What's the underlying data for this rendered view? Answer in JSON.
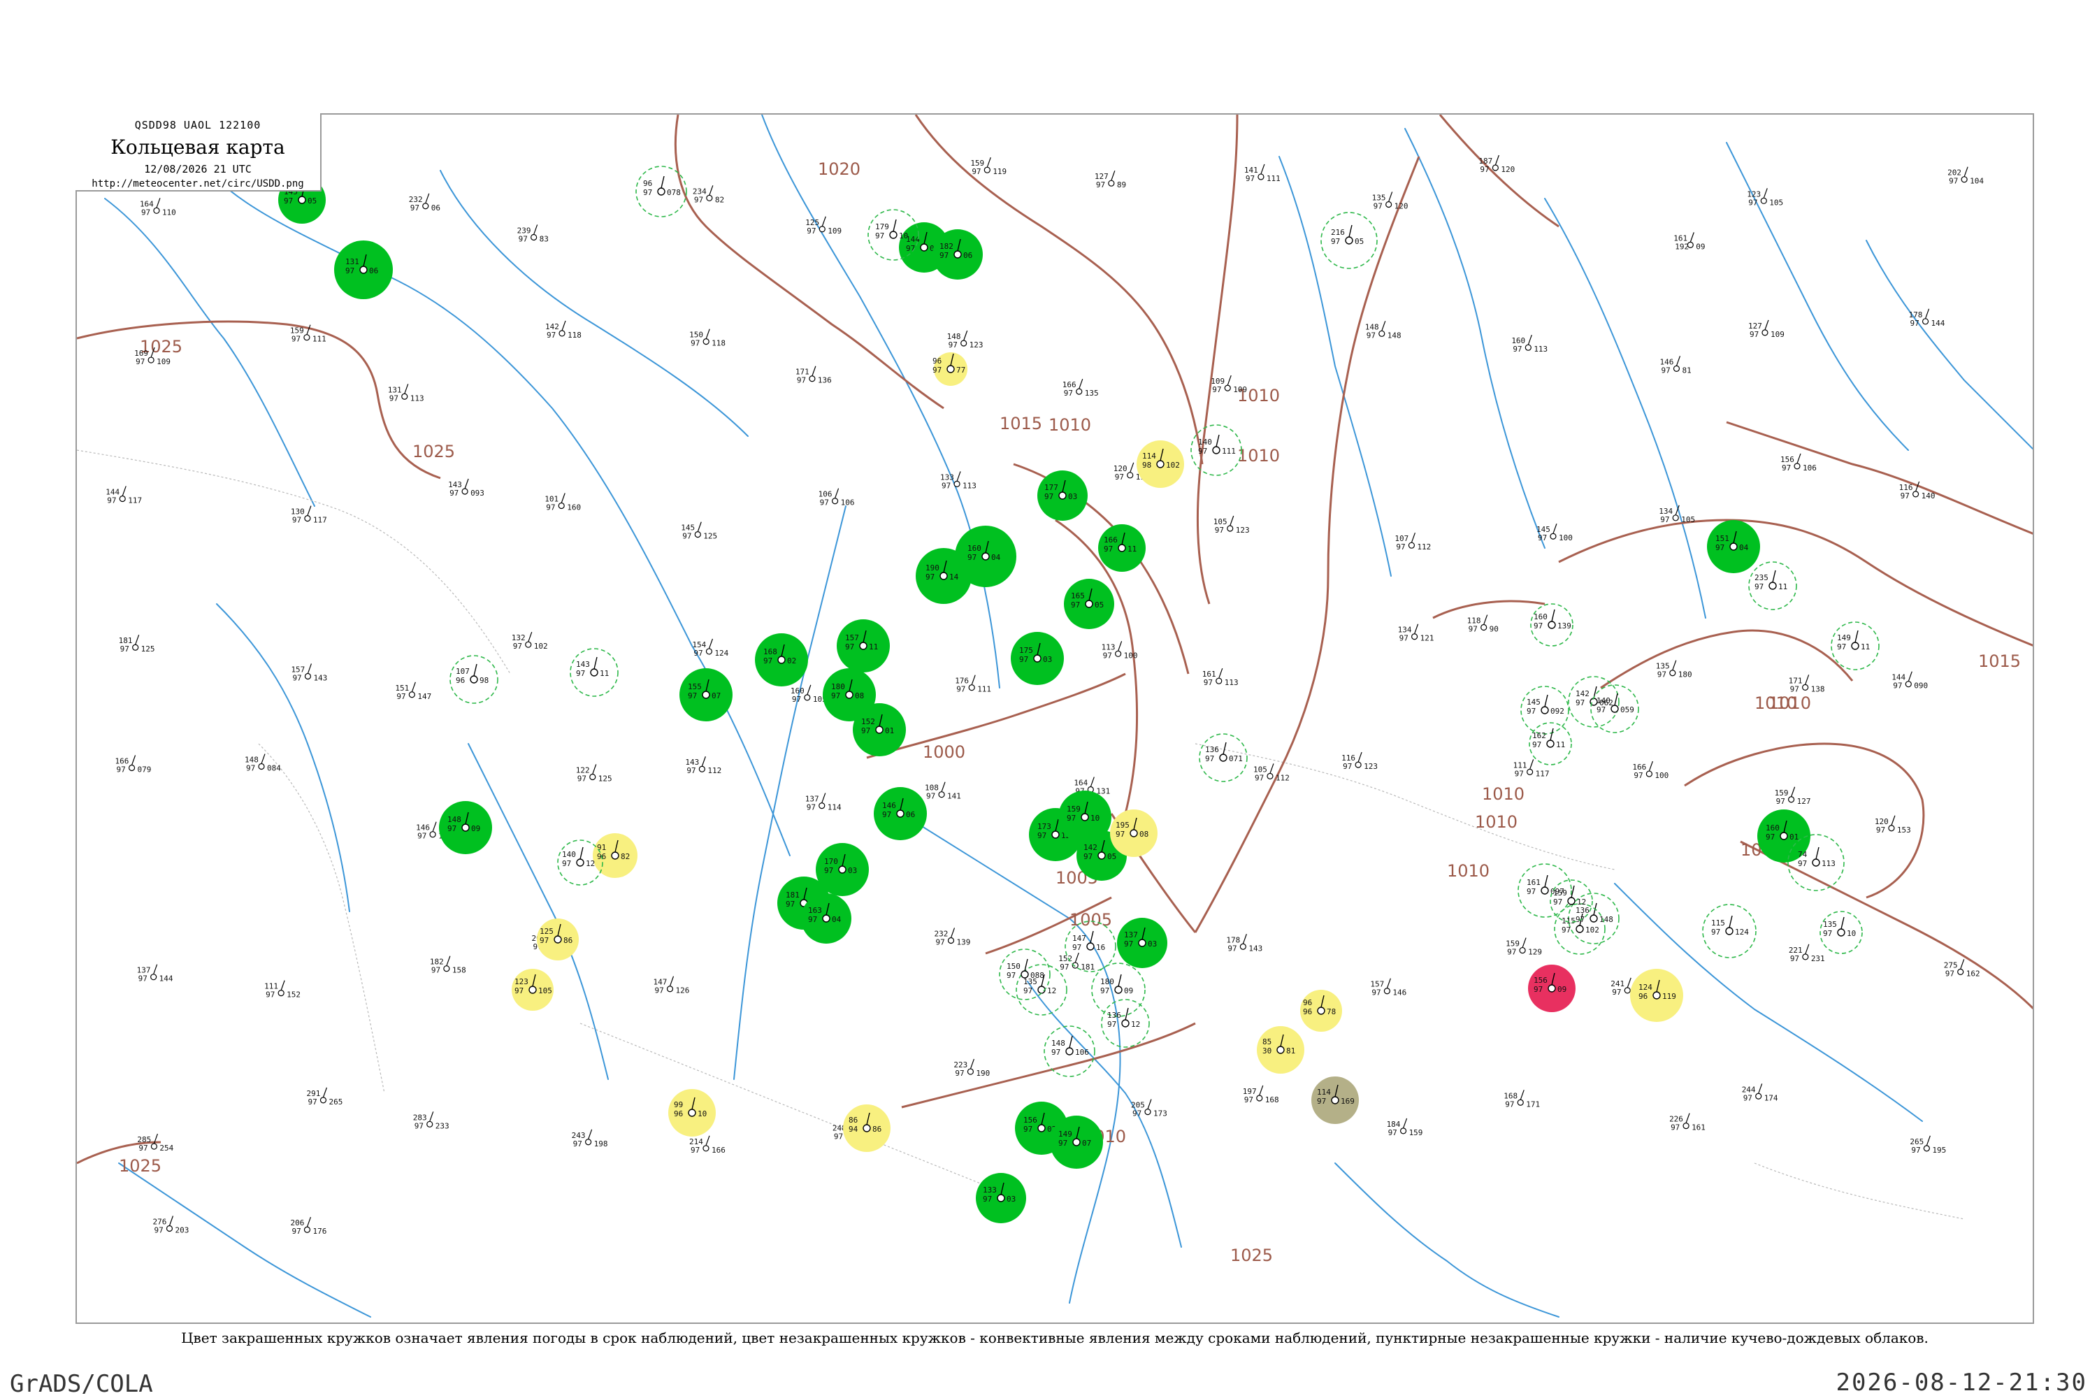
{
  "header": {
    "code": "QSDD98  UAOL  122100",
    "title": "Кольцевая карта",
    "date": "12/08/2026 21 UTC",
    "url": "http://meteocenter.net/circ/USDD.png"
  },
  "caption": "Цвет закрашенных кружков означает явления погоды в срок наблюдений, цвет незакрашенных кружков - конвективные явления между сроками наблюдений, пунктирные незакрашенные кружки - наличие кучево-дождевых облаков.",
  "footer": {
    "left": "GrADS/COLA",
    "right": "2026-08-12-21:30"
  },
  "colors": {
    "rain": "#00c020",
    "drizzle": "#f8f080",
    "thunder_heavy": "#e83060",
    "mixed": "#b4b088",
    "cb_dashed": "#2eb84a",
    "isobar": "#a86050",
    "river": "#3c96d8",
    "border": "#b8b8b8"
  },
  "isobar_labels": [
    {
      "text": "1025"
    },
    {
      "text": "1025"
    },
    {
      "text": "1025"
    },
    {
      "text": "1020"
    },
    {
      "text": "1015"
    },
    {
      "text": "1010"
    },
    {
      "text": "1010"
    },
    {
      "text": "1005"
    },
    {
      "text": "1000"
    },
    {
      "text": "1005"
    },
    {
      "text": "1010"
    },
    {
      "text": "1010"
    },
    {
      "text": "1010"
    },
    {
      "text": "1010"
    },
    {
      "text": "1015"
    },
    {
      "text": "1010"
    },
    {
      "text": "1000"
    },
    {
      "text": "1010"
    },
    {
      "text": "1010"
    },
    {
      "text": "1025"
    }
  ],
  "stations": [
    {
      "kind": "filled",
      "color": "rain",
      "t": "145",
      "p": "97",
      "w": "05"
    },
    {
      "kind": "filled",
      "color": "rain",
      "t": "131",
      "p": "97",
      "w": "06"
    },
    {
      "kind": "filled",
      "color": "rain",
      "t": "144",
      "p": "97",
      "w": "04"
    },
    {
      "kind": "filled",
      "color": "rain",
      "t": "182",
      "p": "97",
      "w": "06"
    },
    {
      "kind": "filled",
      "color": "rain",
      "t": "177",
      "p": "97",
      "w": "03"
    },
    {
      "kind": "filled",
      "color": "rain",
      "t": "166",
      "p": "97",
      "w": "11"
    },
    {
      "kind": "filled",
      "color": "rain",
      "t": "160",
      "p": "97",
      "w": "04"
    },
    {
      "kind": "filled",
      "color": "rain",
      "t": "190",
      "p": "97",
      "w": "14"
    },
    {
      "kind": "filled",
      "color": "rain",
      "t": "165",
      "p": "97",
      "w": "05"
    },
    {
      "kind": "filled",
      "color": "rain",
      "t": "175",
      "p": "97",
      "w": "03"
    },
    {
      "kind": "filled",
      "color": "rain",
      "t": "157",
      "p": "97",
      "w": "11"
    },
    {
      "kind": "filled",
      "color": "rain",
      "t": "168",
      "p": "97",
      "w": "02"
    },
    {
      "kind": "filled",
      "color": "rain",
      "t": "180",
      "p": "97",
      "w": "08"
    },
    {
      "kind": "filled",
      "color": "rain",
      "t": "152",
      "p": "97",
      "w": "01"
    },
    {
      "kind": "filled",
      "color": "rain",
      "t": "170",
      "p": "97",
      "w": "03"
    },
    {
      "kind": "filled",
      "color": "rain",
      "t": "146",
      "p": "97",
      "w": "06"
    },
    {
      "kind": "filled",
      "color": "rain",
      "t": "155",
      "p": "97",
      "w": "07"
    },
    {
      "kind": "filled",
      "color": "rain",
      "t": "148",
      "p": "97",
      "w": "09"
    },
    {
      "kind": "filled",
      "color": "rain",
      "t": "181",
      "p": "97",
      "w": "06"
    },
    {
      "kind": "filled",
      "color": "rain",
      "t": "163",
      "p": "97",
      "w": "04"
    },
    {
      "kind": "filled",
      "color": "rain",
      "t": "173",
      "p": "97",
      "w": "12"
    },
    {
      "kind": "filled",
      "color": "rain",
      "t": "159",
      "p": "97",
      "w": "10"
    },
    {
      "kind": "filled",
      "color": "rain",
      "t": "142",
      "p": "97",
      "w": "05"
    },
    {
      "kind": "filled",
      "color": "rain",
      "t": "137",
      "p": "97",
      "w": "03"
    },
    {
      "kind": "filled",
      "color": "rain",
      "t": "156",
      "p": "97",
      "w": "02"
    },
    {
      "kind": "filled",
      "color": "rain",
      "t": "149",
      "p": "97",
      "w": "07"
    },
    {
      "kind": "filled",
      "color": "rain",
      "t": "133",
      "p": "97",
      "w": "03"
    },
    {
      "kind": "filled",
      "color": "rain",
      "t": "151",
      "p": "97",
      "w": "04"
    },
    {
      "kind": "filled",
      "color": "rain",
      "t": "160",
      "p": "97",
      "w": "01"
    },
    {
      "kind": "filled",
      "color": "drizzle",
      "t": "124",
      "p": "96",
      "w": "119"
    },
    {
      "kind": "filled",
      "color": "drizzle",
      "t": "195",
      "p": "97",
      "w": "08"
    },
    {
      "kind": "filled",
      "color": "drizzle",
      "t": "114",
      "p": "98",
      "w": "102"
    },
    {
      "kind": "filled",
      "color": "drizzle",
      "t": "96",
      "p": "97",
      "w": "77"
    },
    {
      "kind": "filled",
      "color": "drizzle",
      "t": "91",
      "p": "96",
      "w": "82"
    },
    {
      "kind": "filled",
      "color": "drizzle",
      "t": "125",
      "p": "97",
      "w": "86"
    },
    {
      "kind": "filled",
      "color": "drizzle",
      "t": "123",
      "p": "97",
      "w": "105"
    },
    {
      "kind": "filled",
      "color": "drizzle",
      "t": "99",
      "p": "96",
      "w": "10"
    },
    {
      "kind": "filled",
      "color": "drizzle",
      "t": "86",
      "p": "94",
      "w": "86"
    },
    {
      "kind": "filled",
      "color": "drizzle",
      "t": "96",
      "p": "96",
      "w": "78"
    },
    {
      "kind": "filled",
      "color": "drizzle",
      "t": "85",
      "p": "30",
      "w": "81"
    },
    {
      "kind": "filled",
      "color": "mixed",
      "t": "114",
      "p": "97",
      "w": "169"
    },
    {
      "kind": "filled",
      "color": "thunder_heavy",
      "t": "156",
      "p": "97",
      "w": "09"
    },
    {
      "kind": "dashed",
      "color": "cb_dashed",
      "t": "235",
      "p": "97",
      "w": "11"
    },
    {
      "kind": "dashed",
      "color": "cb_dashed",
      "t": "74",
      "p": "97",
      "w": "113"
    },
    {
      "kind": "dashed",
      "color": "cb_dashed",
      "t": "96",
      "p": "97",
      "w": "078"
    },
    {
      "kind": "dashed",
      "color": "cb_dashed",
      "t": "216",
      "p": "97",
      "w": "05"
    },
    {
      "kind": "dashed",
      "color": "cb_dashed",
      "t": "140",
      "p": "97",
      "w": "111"
    },
    {
      "kind": "dashed",
      "color": "cb_dashed",
      "t": "107",
      "p": "96",
      "w": "98"
    },
    {
      "kind": "dashed",
      "color": "cb_dashed",
      "t": "143",
      "p": "97",
      "w": "11"
    },
    {
      "kind": "dashed",
      "color": "cb_dashed",
      "t": "140",
      "p": "97",
      "w": "12"
    },
    {
      "kind": "dashed",
      "color": "cb_dashed",
      "t": "147",
      "p": "97",
      "w": "16"
    },
    {
      "kind": "dashed",
      "color": "cb_dashed",
      "t": "180",
      "p": "97",
      "w": "09"
    },
    {
      "kind": "dashed",
      "color": "cb_dashed",
      "t": "135",
      "p": "97",
      "w": "12"
    },
    {
      "kind": "dashed",
      "color": "cb_dashed",
      "t": "148",
      "p": "97",
      "w": "106"
    },
    {
      "kind": "dashed",
      "color": "cb_dashed",
      "t": "136",
      "p": "97",
      "w": "12"
    },
    {
      "kind": "dashed",
      "color": "cb_dashed",
      "t": "150",
      "p": "97",
      "w": "088"
    },
    {
      "kind": "dashed",
      "color": "cb_dashed",
      "t": "145",
      "p": "97",
      "w": "092"
    },
    {
      "kind": "dashed",
      "color": "cb_dashed",
      "t": "142",
      "p": "97",
      "w": "062"
    },
    {
      "kind": "dashed",
      "color": "cb_dashed",
      "t": "140",
      "p": "97",
      "w": "059"
    },
    {
      "kind": "dashed",
      "color": "cb_dashed",
      "t": "136",
      "p": "97",
      "w": "071"
    },
    {
      "kind": "dashed",
      "color": "cb_dashed",
      "t": "161",
      "p": "97",
      "w": "097"
    },
    {
      "kind": "dashed",
      "color": "cb_dashed",
      "t": "136",
      "p": "97",
      "w": "148"
    },
    {
      "kind": "dashed",
      "color": "cb_dashed",
      "t": "115",
      "p": "97",
      "w": "102"
    },
    {
      "kind": "dashed",
      "color": "cb_dashed",
      "t": "115",
      "p": "97",
      "w": "124"
    },
    {
      "kind": "dashed",
      "color": "cb_dashed",
      "t": "135",
      "p": "97",
      "w": "10"
    },
    {
      "kind": "dashed",
      "color": "cb_dashed",
      "t": "149",
      "p": "97",
      "w": "11"
    },
    {
      "kind": "dashed",
      "color": "cb_dashed",
      "t": "160",
      "p": "97",
      "w": "139"
    },
    {
      "kind": "dashed",
      "color": "cb_dashed",
      "t": "162",
      "p": "97",
      "w": "11"
    },
    {
      "kind": "dashed",
      "color": "cb_dashed",
      "t": "159",
      "p": "97",
      "w": "12"
    },
    {
      "kind": "dashed",
      "color": "cb_dashed",
      "t": "179",
      "p": "97",
      "w": "10"
    }
  ],
  "small_stations": [
    {
      "a": "164",
      "b": "97",
      "c": "110"
    },
    {
      "a": "118",
      "b": "98",
      "c": "104"
    },
    {
      "a": "232",
      "b": "97",
      "c": "06"
    },
    {
      "a": "239",
      "b": "97",
      "c": "83"
    },
    {
      "a": "234",
      "b": "97",
      "c": "82"
    },
    {
      "a": "125",
      "b": "97",
      "c": "109"
    },
    {
      "a": "159",
      "b": "97",
      "c": "119"
    },
    {
      "a": "127",
      "b": "97",
      "c": "89"
    },
    {
      "a": "141",
      "b": "97",
      "c": "111"
    },
    {
      "a": "135",
      "b": "97",
      "c": "120"
    },
    {
      "a": "187",
      "b": "97",
      "c": "120"
    },
    {
      "a": "161",
      "b": "192",
      "c": "09"
    },
    {
      "a": "123",
      "b": "97",
      "c": "105"
    },
    {
      "a": "202",
      "b": "97",
      "c": "104"
    },
    {
      "a": "169",
      "b": "97",
      "c": "109"
    },
    {
      "a": "159",
      "b": "97",
      "c": "111"
    },
    {
      "a": "131",
      "b": "97",
      "c": "113"
    },
    {
      "a": "142",
      "b": "97",
      "c": "118"
    },
    {
      "a": "150",
      "b": "97",
      "c": "118"
    },
    {
      "a": "171",
      "b": "97",
      "c": "136"
    },
    {
      "a": "148",
      "b": "97",
      "c": "123"
    },
    {
      "a": "166",
      "b": "97",
      "c": "135"
    },
    {
      "a": "109",
      "b": "97",
      "c": "109"
    },
    {
      "a": "148",
      "b": "97",
      "c": "148"
    },
    {
      "a": "160",
      "b": "97",
      "c": "113"
    },
    {
      "a": "146",
      "b": "97",
      "c": "81"
    },
    {
      "a": "127",
      "b": "97",
      "c": "109"
    },
    {
      "a": "178",
      "b": "97",
      "c": "144"
    },
    {
      "a": "144",
      "b": "97",
      "c": "117"
    },
    {
      "a": "130",
      "b": "97",
      "c": "117"
    },
    {
      "a": "143",
      "b": "97",
      "c": "093"
    },
    {
      "a": "101",
      "b": "97",
      "c": "160"
    },
    {
      "a": "145",
      "b": "97",
      "c": "125"
    },
    {
      "a": "106",
      "b": "97",
      "c": "106"
    },
    {
      "a": "133",
      "b": "97",
      "c": "113"
    },
    {
      "a": "120",
      "b": "97",
      "c": "110"
    },
    {
      "a": "105",
      "b": "97",
      "c": "123"
    },
    {
      "a": "107",
      "b": "97",
      "c": "112"
    },
    {
      "a": "145",
      "b": "97",
      "c": "100"
    },
    {
      "a": "134",
      "b": "97",
      "c": "105"
    },
    {
      "a": "156",
      "b": "97",
      "c": "106"
    },
    {
      "a": "116",
      "b": "97",
      "c": "140"
    },
    {
      "a": "181",
      "b": "97",
      "c": "125"
    },
    {
      "a": "157",
      "b": "97",
      "c": "143"
    },
    {
      "a": "151",
      "b": "97",
      "c": "147"
    },
    {
      "a": "132",
      "b": "97",
      "c": "102"
    },
    {
      "a": "154",
      "b": "97",
      "c": "124"
    },
    {
      "a": "160",
      "b": "97",
      "c": "105"
    },
    {
      "a": "176",
      "b": "97",
      "c": "111"
    },
    {
      "a": "113",
      "b": "97",
      "c": "100"
    },
    {
      "a": "161",
      "b": "97",
      "c": "113"
    },
    {
      "a": "134",
      "b": "97",
      "c": "121"
    },
    {
      "a": "118",
      "b": "97",
      "c": "90"
    },
    {
      "a": "135",
      "b": "97",
      "c": "180"
    },
    {
      "a": "171",
      "b": "97",
      "c": "138"
    },
    {
      "a": "144",
      "b": "97",
      "c": "090"
    },
    {
      "a": "166",
      "b": "97",
      "c": "079"
    },
    {
      "a": "148",
      "b": "97",
      "c": "084"
    },
    {
      "a": "146",
      "b": "97",
      "c": "122"
    },
    {
      "a": "122",
      "b": "97",
      "c": "125"
    },
    {
      "a": "143",
      "b": "97",
      "c": "112"
    },
    {
      "a": "137",
      "b": "97",
      "c": "114"
    },
    {
      "a": "108",
      "b": "97",
      "c": "141"
    },
    {
      "a": "164",
      "b": "97",
      "c": "131"
    },
    {
      "a": "105",
      "b": "97",
      "c": "112"
    },
    {
      "a": "116",
      "b": "97",
      "c": "123"
    },
    {
      "a": "111",
      "b": "97",
      "c": "117"
    },
    {
      "a": "166",
      "b": "97",
      "c": "100"
    },
    {
      "a": "159",
      "b": "97",
      "c": "127"
    },
    {
      "a": "120",
      "b": "97",
      "c": "153"
    },
    {
      "a": "137",
      "b": "97",
      "c": "144"
    },
    {
      "a": "111",
      "b": "97",
      "c": "152"
    },
    {
      "a": "182",
      "b": "97",
      "c": "158"
    },
    {
      "a": "209",
      "b": "97",
      "c": "137"
    },
    {
      "a": "147",
      "b": "97",
      "c": "126"
    },
    {
      "a": "99",
      "b": "97",
      "c": "127"
    },
    {
      "a": "232",
      "b": "97",
      "c": "139"
    },
    {
      "a": "152",
      "b": "97",
      "c": "181"
    },
    {
      "a": "178",
      "b": "97",
      "c": "143"
    },
    {
      "a": "157",
      "b": "97",
      "c": "146"
    },
    {
      "a": "159",
      "b": "97",
      "c": "129"
    },
    {
      "a": "241",
      "b": "97",
      "c": "163"
    },
    {
      "a": "221",
      "b": "97",
      "c": "231"
    },
    {
      "a": "275",
      "b": "97",
      "c": "162"
    },
    {
      "a": "285",
      "b": "97",
      "c": "254"
    },
    {
      "a": "291",
      "b": "97",
      "c": "265"
    },
    {
      "a": "283",
      "b": "97",
      "c": "233"
    },
    {
      "a": "243",
      "b": "97",
      "c": "198"
    },
    {
      "a": "214",
      "b": "97",
      "c": "166"
    },
    {
      "a": "248",
      "b": "97",
      "c": "220"
    },
    {
      "a": "223",
      "b": "97",
      "c": "190"
    },
    {
      "a": "205",
      "b": "97",
      "c": "173"
    },
    {
      "a": "197",
      "b": "97",
      "c": "168"
    },
    {
      "a": "184",
      "b": "97",
      "c": "159"
    },
    {
      "a": "168",
      "b": "97",
      "c": "171"
    },
    {
      "a": "226",
      "b": "97",
      "c": "161"
    },
    {
      "a": "244",
      "b": "97",
      "c": "174"
    },
    {
      "a": "265",
      "b": "97",
      "c": "195"
    },
    {
      "a": "276",
      "b": "97",
      "c": "203"
    },
    {
      "a": "206",
      "b": "97",
      "c": "176"
    }
  ]
}
